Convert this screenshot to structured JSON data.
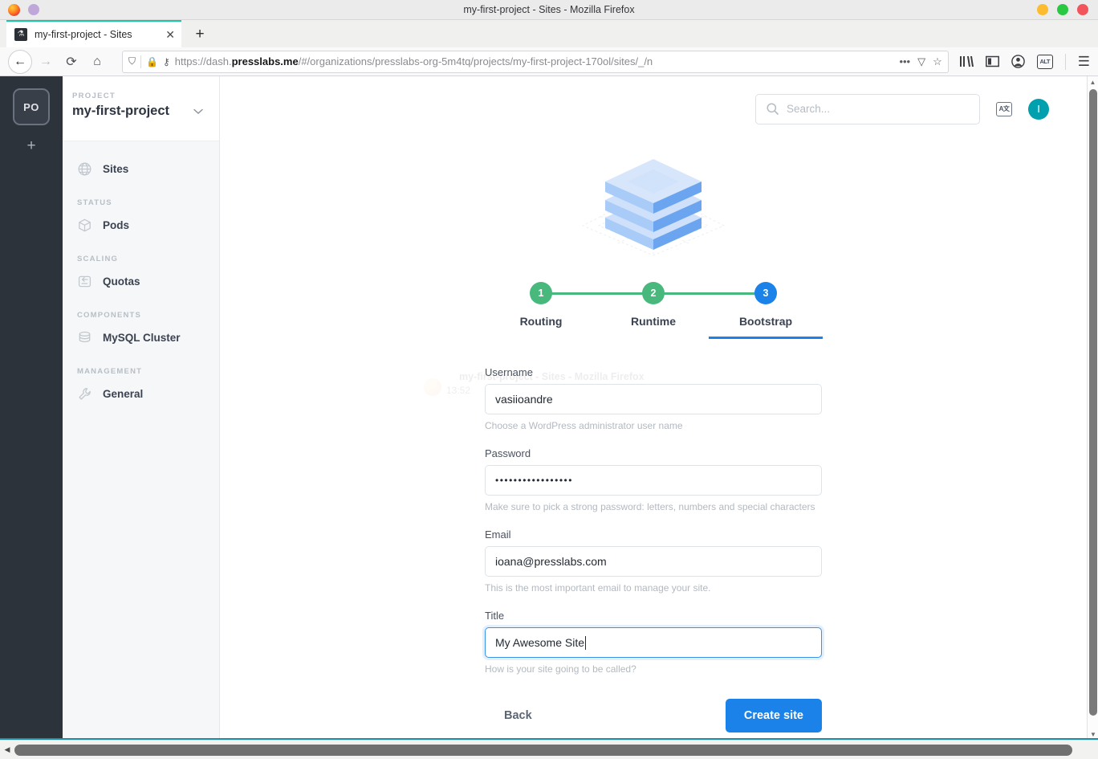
{
  "window": {
    "title": "my-first-project - Sites - Mozilla Firefox",
    "dots": {
      "left_logo": "firefox-logo",
      "left_purple": "#bfa8d9"
    },
    "controls": {
      "minimize": "#fdbc2f",
      "maximize": "#28c940",
      "close": "#f2545b"
    }
  },
  "browser": {
    "tab": {
      "title": "my-first-project - Sites",
      "favicon": "⚗",
      "close": "✕"
    },
    "newtab_label": "+",
    "nav": {
      "back": "←",
      "forward": "→",
      "reload": "⟳",
      "home": "⌂"
    },
    "url": {
      "prefix": "https://dash.",
      "bold": "presslabs.me",
      "suffix": "/#/organizations/presslabs-org-5m4tq/projects/my-first-project-170ol/sites/_/n",
      "shield": "⛉",
      "lock": "🔒",
      "key": "⚷",
      "more": "•••",
      "pocket": "▽",
      "bookmark": "☆"
    },
    "toolbar": {
      "library": "library-icon",
      "sidebar": "sidebar-icon",
      "account": "account-icon",
      "alt_ext": "ALT",
      "menu": "☰"
    }
  },
  "rail": {
    "org_initials": "PO",
    "add_label": "+"
  },
  "sidebar": {
    "kicker": "PROJECT",
    "project_name": "my-first-project",
    "caret": "⌄",
    "items": [
      {
        "label": "Sites",
        "icon": "globe-icon",
        "group": null
      },
      {
        "label": "STATUS",
        "type": "group"
      },
      {
        "label": "Pods",
        "icon": "cube-icon"
      },
      {
        "label": "SCALING",
        "type": "group"
      },
      {
        "label": "Quotas",
        "icon": "resize-icon"
      },
      {
        "label": "COMPONENTS",
        "type": "group"
      },
      {
        "label": "MySQL Cluster",
        "icon": "database-icon"
      },
      {
        "label": "MANAGEMENT",
        "type": "group"
      },
      {
        "label": "General",
        "icon": "wrench-icon"
      }
    ],
    "nav": {
      "sites": "Sites",
      "status_group": "STATUS",
      "pods": "Pods",
      "scaling_group": "SCALING",
      "quotas": "Quotas",
      "components_group": "COMPONENTS",
      "mysql": "MySQL Cluster",
      "management_group": "MANAGEMENT",
      "general": "General"
    }
  },
  "topbar": {
    "search_placeholder": "Search...",
    "search_value": "",
    "translate_label": "A文",
    "avatar_initial": "I",
    "avatar_color": "#00a0ae"
  },
  "wizard": {
    "steps": [
      {
        "number": "1",
        "label": "Routing",
        "state": "done",
        "color": "#49b87c"
      },
      {
        "number": "2",
        "label": "Runtime",
        "state": "done",
        "color": "#49b87c"
      },
      {
        "number": "3",
        "label": "Bootstrap",
        "state": "active",
        "color": "#1a82e8"
      }
    ],
    "connector_color": "#49b87c",
    "active_underline_color": "#1a82e8"
  },
  "ghost_artifact": {
    "line1": "my-first-project - Sites - Mozilla Firefox",
    "line2": "13:52"
  },
  "form": {
    "fields": [
      {
        "label": "Username",
        "value": "vasiioandre",
        "hint": "Choose a WordPress administrator user name",
        "focused": false,
        "type": "text"
      },
      {
        "label": "Password",
        "value": "•••••••••••••••••",
        "hint": "Make sure to pick a strong password: letters, numbers and special characters",
        "focused": false,
        "type": "password"
      },
      {
        "label": "Email",
        "value": "ioana@presslabs.com",
        "hint": "This is the most important email to manage your site.",
        "focused": false,
        "type": "email"
      },
      {
        "label": "Title",
        "value": "My Awesome Site",
        "hint": "How is your site going to be called?",
        "focused": true,
        "type": "text"
      }
    ]
  },
  "actions": {
    "back_label": "Back",
    "create_label": "Create site",
    "create_color": "#1a82e8"
  }
}
